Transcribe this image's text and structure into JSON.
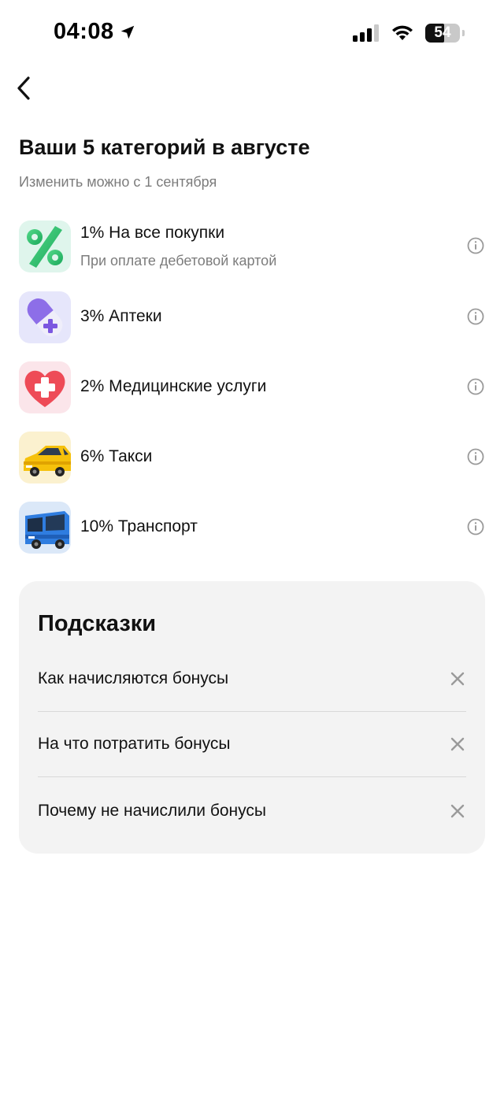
{
  "status_bar": {
    "time": "04:08",
    "battery": "54",
    "battery_level": 0.54
  },
  "header": {
    "title": "Ваши 5 категорий в августе",
    "subtitle": "Изменить можно с 1 сентября"
  },
  "categories": [
    {
      "title": "1% На все покупки",
      "description": "При оплате дебетовой картой",
      "icon": "percent-icon"
    },
    {
      "title": "3% Аптеки",
      "icon": "pill-icon"
    },
    {
      "title": "2% Медицинские услуги",
      "icon": "medical-heart-icon"
    },
    {
      "title": "6% Такси",
      "icon": "taxi-car-icon"
    },
    {
      "title": "10% Транспорт",
      "icon": "bus-icon"
    }
  ],
  "hints": {
    "title": "Подсказки",
    "items": [
      {
        "label": "Как начисляются бонусы"
      },
      {
        "label": "На что потратить бонусы"
      },
      {
        "label": "Почему не начислили бонусы"
      }
    ]
  },
  "colors": {
    "text": "#111111",
    "secondary_text": "#7c7c7c",
    "card_bg": "#f3f3f3",
    "icon_gray": "#9a9a9a"
  }
}
